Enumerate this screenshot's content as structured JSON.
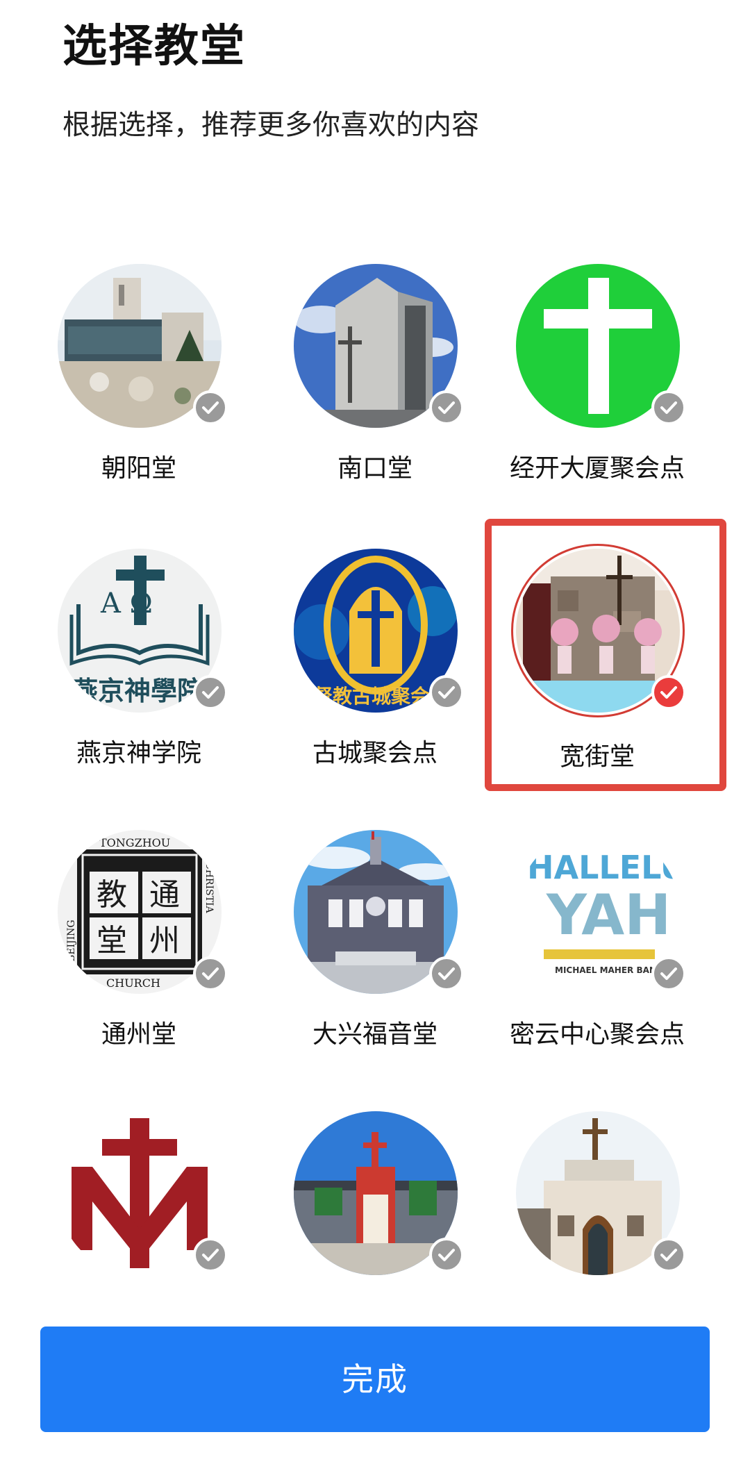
{
  "header": {
    "title": "选择教堂",
    "subtitle": "根据选择，推荐更多你喜欢的内容"
  },
  "churches": [
    {
      "name": "朝阳堂",
      "selected": false
    },
    {
      "name": "南口堂",
      "selected": false
    },
    {
      "name": "经开大厦聚会点",
      "selected": false
    },
    {
      "name": "燕京神学院",
      "selected": false
    },
    {
      "name": "古城聚会点",
      "selected": false
    },
    {
      "name": "宽街堂",
      "selected": true
    },
    {
      "name": "通州堂",
      "selected": false
    },
    {
      "name": "大兴福音堂",
      "selected": false
    },
    {
      "name": "密云中心聚会点",
      "selected": false
    },
    {
      "name": "",
      "selected": false
    },
    {
      "name": "",
      "selected": false
    },
    {
      "name": "",
      "selected": false
    }
  ],
  "logos": {
    "seminary_letters": "A Ω",
    "seminary_text": "燕京神學院",
    "tongzhou_chars": [
      "教",
      "通",
      "堂",
      "州"
    ],
    "tongzhou_top": "TONGZHOU",
    "tongzhou_bottom": "CHURCH",
    "tongzhou_left": "BEIJING",
    "tongzhou_right": "CHRISTIA",
    "gucheng_text": "基督教古城聚会",
    "hallelujah_top": "HALLELU",
    "hallelujah_bottom": "YAH",
    "hallelujah_band": "MICHAEL MAHER BAND"
  },
  "colors": {
    "selected_red": "#e0473e",
    "check_gray": "#9a9a9a",
    "button_blue": "#1f7cf5",
    "cross_green": "#1fcf3a"
  },
  "footer": {
    "done_label": "完成"
  }
}
